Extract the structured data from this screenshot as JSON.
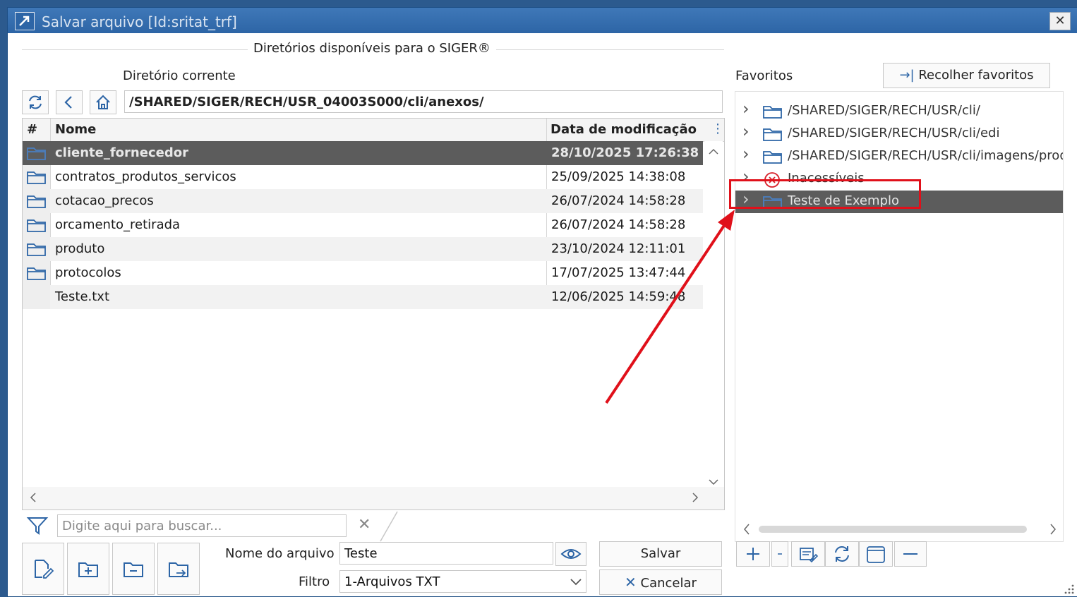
{
  "window": {
    "title": "Salvar arquivo [Id:sritat_trf]",
    "close_label": "✕"
  },
  "section_title": "Diretórios disponíveis para o SIGER®",
  "current_dir": {
    "label": "Diretório corrente",
    "path": "/SHARED/SIGER/RECH/USR_04003S000/cli/anexos/"
  },
  "table": {
    "headers": {
      "num": "#",
      "name": "Nome",
      "date": "Data de modificação"
    },
    "rows": [
      {
        "name": "cliente_fornecedor",
        "date": "28/10/2025 17:26:38",
        "type": "folder",
        "selected": true
      },
      {
        "name": "contratos_produtos_servicos",
        "date": "25/09/2025 14:38:08",
        "type": "folder"
      },
      {
        "name": "cotacao_precos",
        "date": "26/07/2024 14:58:28",
        "type": "folder"
      },
      {
        "name": "orcamento_retirada",
        "date": "26/07/2024 14:58:28",
        "type": "folder"
      },
      {
        "name": "produto",
        "date": "23/10/2024 12:11:01",
        "type": "folder"
      },
      {
        "name": "protocolos",
        "date": "17/07/2025 13:47:44",
        "type": "folder"
      },
      {
        "name": "Teste.txt",
        "date": "12/06/2025 14:59:48",
        "type": "file"
      }
    ]
  },
  "search": {
    "placeholder": "Digite aqui para buscar..."
  },
  "filename": {
    "label": "Nome do arquivo",
    "value": "Teste"
  },
  "filter": {
    "label": "Filtro",
    "value": "1-Arquivos TXT"
  },
  "buttons": {
    "save": "Salvar",
    "cancel": "Cancelar"
  },
  "favorites": {
    "label": "Favoritos",
    "collapse_button": "Recolher favoritos",
    "items": [
      {
        "text": "/SHARED/SIGER/RECH/USR/cli/",
        "icon": "folder-icon"
      },
      {
        "text": "/SHARED/SIGER/RECH/USR/cli/edi",
        "icon": "folder-open-icon"
      },
      {
        "text": "/SHARED/SIGER/RECH/USR/cli/imagens/produ",
        "icon": "folder-icon"
      },
      {
        "text": "Inacessíveis",
        "icon": "error-icon"
      },
      {
        "text": "Teste de Exemplo",
        "icon": "folder-icon",
        "selected": true
      }
    ]
  },
  "colors": {
    "selected_row": "#5c5c5c",
    "annotation": "#e0101a",
    "title_bar": "#2d65a6"
  }
}
